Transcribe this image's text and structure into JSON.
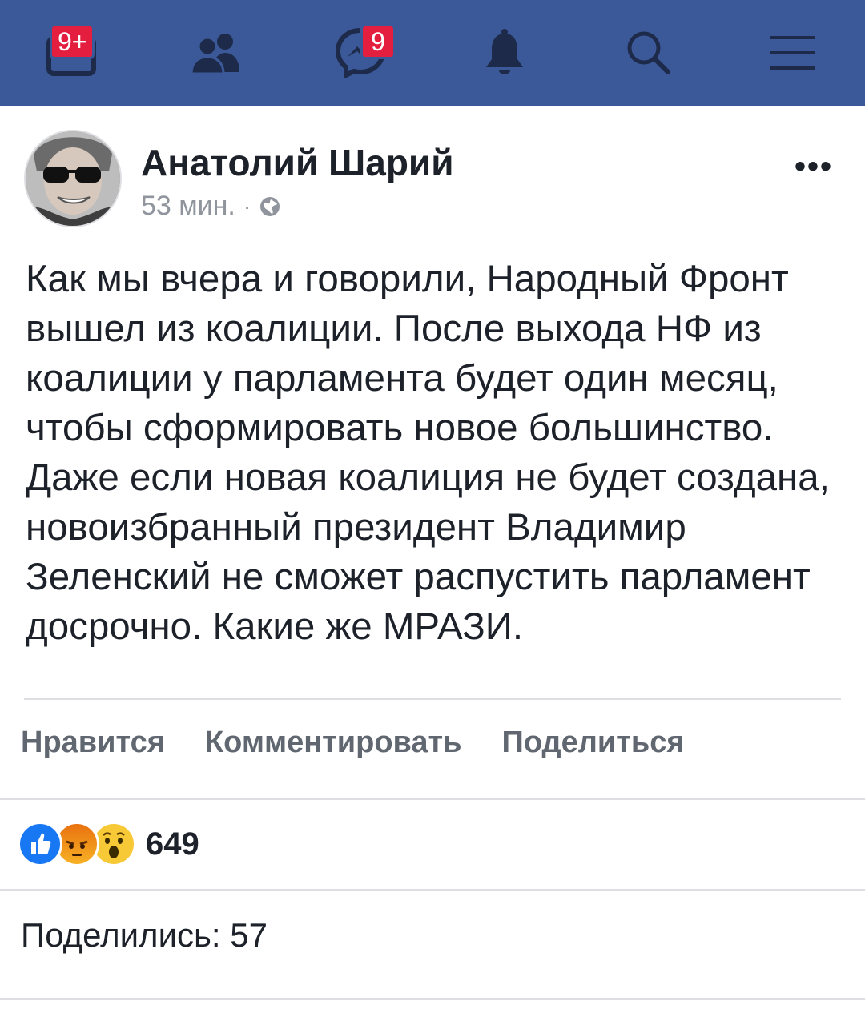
{
  "nav": {
    "items": [
      {
        "icon": "news-feed-icon",
        "badge": "9+"
      },
      {
        "icon": "friends-icon",
        "badge": ""
      },
      {
        "icon": "messenger-icon",
        "badge": "9"
      },
      {
        "icon": "bell-icon",
        "badge": ""
      },
      {
        "icon": "search-icon",
        "badge": ""
      },
      {
        "icon": "menu-icon",
        "badge": ""
      }
    ],
    "colors": {
      "bar": "#3b5998",
      "badge": "#e41e3f",
      "icon": "#1d2a4a"
    }
  },
  "post": {
    "author": "Анатолий Шарий",
    "time": "53 мин.",
    "separator": "·",
    "privacy_icon": "globe-icon",
    "more": "•••",
    "text": "Как мы вчера и говорили, Народный Фронт вышел из коалиции. После выхода НФ из коалиции у парламента будет один месяц, чтобы сформировать новое большинство. Даже если новая коалиция не будет создана, новоизбранный президент Владимир Зеленский не сможет распустить парламент досрочно. Какие же МРАЗИ."
  },
  "actions": {
    "like": "Нравится",
    "comment": "Комментировать",
    "share": "Поделиться"
  },
  "reactions": {
    "icons": [
      "like-reaction-icon",
      "angry-reaction-icon",
      "wow-reaction-icon"
    ],
    "count": "649"
  },
  "shares": {
    "label": "Поделились: 57"
  }
}
